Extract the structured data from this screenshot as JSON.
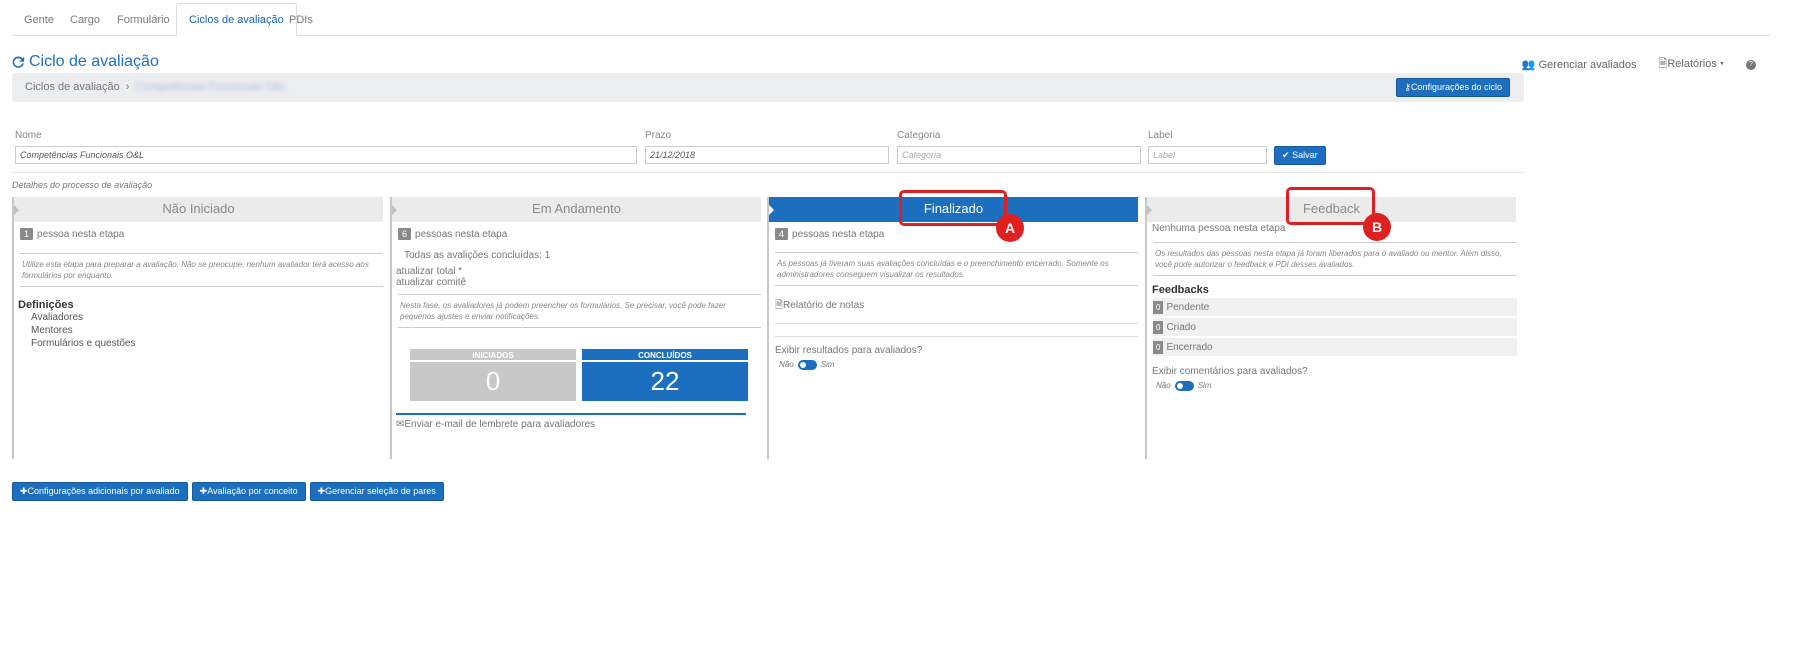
{
  "tabs": [
    "Gente",
    "Cargo",
    "Formulário",
    "Ciclos de avaliação",
    "PDIs"
  ],
  "page_title": "Ciclo de avaliação",
  "top_actions": {
    "manage": "Gerenciar avaliados",
    "reports": "Relatórios",
    "help": "?"
  },
  "breadcrumb": {
    "root": "Ciclos de avaliação",
    "current": "Competências Funcionais O&L"
  },
  "config_button": "Configurações do ciclo",
  "form": {
    "nome_label": "Nome",
    "nome_value": "Competências Funcionais O&L",
    "prazo_label": "Prazo",
    "prazo_value": "21/12/2018",
    "categoria_label": "Categoria",
    "categoria_placeholder": "Categoria",
    "label_label": "Label",
    "label_placeholder": "Label",
    "save": "Salvar"
  },
  "details_label": "Detalhes do processo de avaliação",
  "stages": {
    "nao_iniciado": {
      "title": "Não Iniciado",
      "count": "1",
      "count_text": "pessoa nesta etapa",
      "help": "Utilize esta etapa para preparar a avaliação. Não se preocupe, nenhum avaliador terá acesso aos formulários por enquanto.",
      "definitions_title": "Definições",
      "definitions": [
        "Avaliadores",
        "Mentores",
        "Formulários e questões"
      ]
    },
    "em_andamento": {
      "title": "Em Andamento",
      "count": "6",
      "count_text": "pessoas nesta etapa",
      "all_done": "Todas as avalições concluídas: 1",
      "update_total": "atualizar total *",
      "update_committee": "atualizar comitê",
      "help": "Nesta fase, os avaliadores já podem preencher os formulários. Se precisar, você pode fazer pequenos ajustes e enviar notificações.",
      "started_label": "INICIADOS",
      "started_value": "0",
      "done_label": "CONCLUÍDOS",
      "done_value": "22",
      "reminder": "Enviar e-mail de lembrete para avaliadores"
    },
    "finalizado": {
      "title": "Finalizado",
      "count": "4",
      "count_text": "pessoas nesta etapa",
      "help": "As pessoas já tiveram suas avaliações concluídas e o preenchimento encerrado. Somente os administradores conseguem visualizar os resultados.",
      "report": "Relatório de notas",
      "show_results": "Exibir resultados para avaliados?",
      "no": "Não",
      "yes": "Sim"
    },
    "feedback": {
      "title": "Feedback",
      "count_text": "Nenhuma pessoa nesta etapa",
      "help": "Os resultados das pessoas nesta etapa já foram liberados para o avaliado ou mentor. Além disso, você pode autorizar o feedback e PDI desses avaliados.",
      "feedbacks_title": "Feedbacks",
      "rows": [
        {
          "count": "0",
          "label": "Pendente"
        },
        {
          "count": "0",
          "label": "Criado"
        },
        {
          "count": "0",
          "label": "Encerrado"
        }
      ],
      "show_comments": "Exibir comentários para avaliados?",
      "no": "Não",
      "yes": "Sim"
    }
  },
  "markers": {
    "a": "A",
    "b": "B"
  },
  "bottom_buttons": [
    "Configurações adicionais por avaliado",
    "Avaliação por conceito",
    "Gerenciar seleção de pares"
  ],
  "colors": {
    "accent": "#1c6fbf",
    "marker": "#e02020",
    "header_gray": "#ebebeb"
  }
}
